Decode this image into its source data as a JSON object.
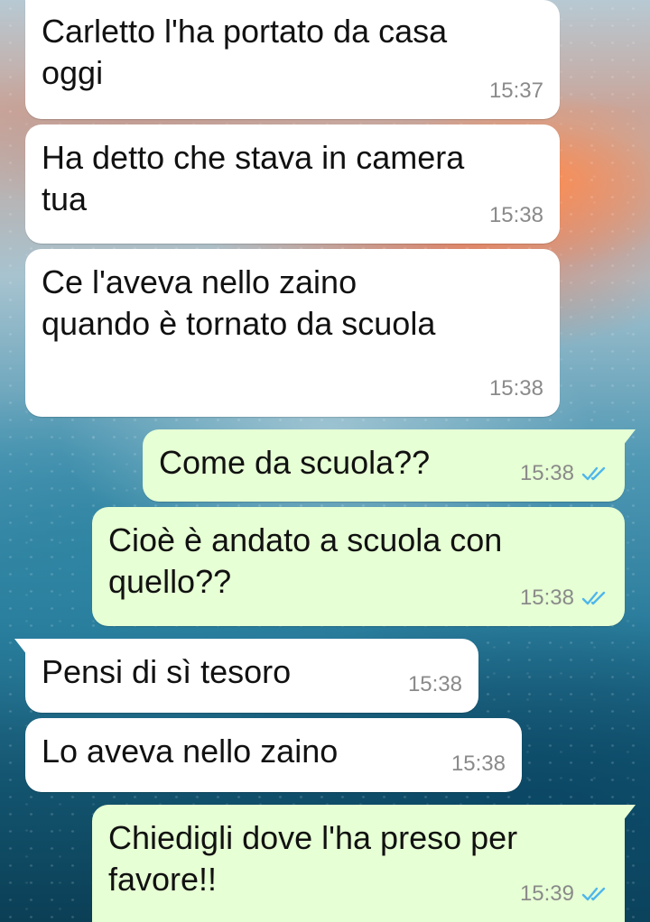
{
  "messages": [
    {
      "direction": "in",
      "text": "Carletto l'ha portato da casa\noggi",
      "time": "15:37"
    },
    {
      "direction": "in",
      "text": "Ha detto che stava in camera\ntua",
      "time": "15:38"
    },
    {
      "direction": "in",
      "text": "Ce l'aveva nello zaino\nquando è tornato da scuola",
      "time": "15:38"
    },
    {
      "direction": "out",
      "text": "Come da scuola??",
      "time": "15:38",
      "status": "read",
      "status_icon": "double-check-icon"
    },
    {
      "direction": "out",
      "text": "Cioè è andato a scuola con\nquello??",
      "time": "15:38",
      "status": "read",
      "status_icon": "double-check-icon"
    },
    {
      "direction": "in",
      "text": "Pensi di sì tesoro",
      "time": "15:38"
    },
    {
      "direction": "in",
      "text": "Lo aveva nello zaino",
      "time": "15:38"
    },
    {
      "direction": "out",
      "text": "Chiedigli dove l'ha preso per\nfavore!!",
      "time": "15:39",
      "status": "read",
      "status_icon": "double-check-icon"
    }
  ],
  "colors": {
    "incoming_bubble": "#ffffff",
    "outgoing_bubble": "#e6ffd4",
    "read_ticks": "#4fb6ec",
    "timestamp": "#8a8a8a"
  }
}
